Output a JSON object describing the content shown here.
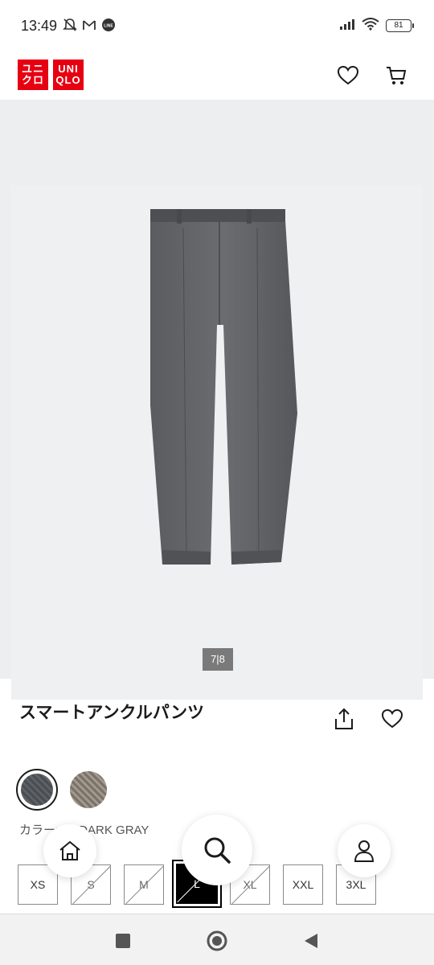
{
  "status_bar": {
    "time": "13:49",
    "battery": "81",
    "icons_left": [
      "mute-bell-icon",
      "gmail-icon",
      "line-icon"
    ],
    "icons_right": [
      "signal-icon",
      "wifi-icon",
      "battery-icon"
    ]
  },
  "header": {
    "logo_top": "ユニ",
    "logo_top_2": "クロ",
    "logo_right_top": "UNI",
    "logo_right_bottom": "QLO",
    "icons": [
      "heart-icon",
      "cart-icon"
    ]
  },
  "gallery": {
    "counter": "7|8"
  },
  "product": {
    "title": "スマートアンクルパンツ",
    "color_label": "カラー: 08 DARK GRAY",
    "colors": [
      "#4e5156",
      "#8e857a"
    ]
  },
  "sizes": [
    {
      "label": "XS",
      "state": "available"
    },
    {
      "label": "S",
      "state": "out"
    },
    {
      "label": "M",
      "state": "out"
    },
    {
      "label": "L",
      "state": "selected"
    },
    {
      "label": "XL",
      "state": "out"
    },
    {
      "label": "XXL",
      "state": "available"
    },
    {
      "label": "3XL",
      "state": "available"
    }
  ],
  "nav_icons": [
    "home-icon",
    "search-icon",
    "account-icon"
  ],
  "colors": {
    "brand_red": "#e60012",
    "gallery_bg": "#eceef0"
  }
}
